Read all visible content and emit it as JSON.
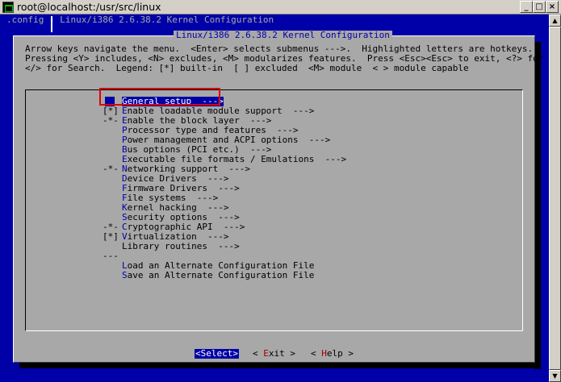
{
  "window": {
    "title": "root@localhost:/usr/src/linux",
    "min_glyph": "_",
    "max_glyph": "□",
    "close_glyph": "×"
  },
  "terminal": {
    "backtitle": ".config - Linux/i386 2.6.38.2 Kernel Configuration",
    "dialog_title": "Linux/i386 2.6.38.2 Kernel Configuration",
    "help_lines": [
      "Arrow keys navigate the menu.  <Enter> selects submenus --->.  Highlighted letters are hotkeys.",
      "Pressing <Y> includes, <N> excludes, <M> modularizes features.  Press <Esc><Esc> to exit, <?> for Help,",
      "</> for Search.  Legend: [*] built-in  [ ] excluded  <M> module  < > module capable"
    ]
  },
  "menu": {
    "items": [
      {
        "prefix": "",
        "hotkey": "G",
        "rest": "eneral setup  --->",
        "selected": true
      },
      {
        "prefix": "[*]",
        "hotkey": "E",
        "rest": "nable loadable module support  --->",
        "selected": false
      },
      {
        "prefix": "-*-",
        "hotkey": "E",
        "rest": "nable the block layer  --->",
        "selected": false
      },
      {
        "prefix": "",
        "hotkey": "P",
        "rest": "rocessor type and features  --->",
        "selected": false
      },
      {
        "prefix": "",
        "hotkey": "P",
        "rest": "ower management and ACPI options  --->",
        "selected": false
      },
      {
        "prefix": "",
        "hotkey": "B",
        "rest": "us options (PCI etc.)  --->",
        "selected": false
      },
      {
        "prefix": "",
        "hotkey": "E",
        "rest": "xecutable file formats / Emulations  --->",
        "selected": false
      },
      {
        "prefix": "-*-",
        "hotkey": "N",
        "rest": "etworking support  --->",
        "selected": false
      },
      {
        "prefix": "",
        "hotkey": "D",
        "rest": "evice Drivers  --->",
        "selected": false
      },
      {
        "prefix": "",
        "hotkey": "F",
        "rest": "irmware Drivers  --->",
        "selected": false
      },
      {
        "prefix": "",
        "hotkey": "F",
        "rest": "ile systems  --->",
        "selected": false
      },
      {
        "prefix": "",
        "hotkey": "K",
        "rest": "ernel hacking  --->",
        "selected": false
      },
      {
        "prefix": "",
        "hotkey": "S",
        "rest": "ecurity options  --->",
        "selected": false
      },
      {
        "prefix": "-*-",
        "hotkey": "C",
        "rest": "ryptographic API  --->",
        "selected": false
      },
      {
        "prefix": "[*]",
        "hotkey": "V",
        "rest": "irtualization  --->",
        "selected": false
      },
      {
        "prefix": "",
        "hotkey": "",
        "rest": "Library routines  --->",
        "selected": false
      },
      {
        "prefix": "---",
        "hotkey": "",
        "rest": "",
        "selected": false
      },
      {
        "prefix": "",
        "hotkey": "L",
        "rest": "oad an Alternate Configuration File",
        "selected": false
      },
      {
        "prefix": "",
        "hotkey": "S",
        "rest": "ave an Alternate Configuration File",
        "selected": false
      }
    ]
  },
  "buttons": {
    "select": {
      "pre": "<",
      "hotkey": "S",
      "rest": "elect>"
    },
    "exit": {
      "pre": "< ",
      "hotkey": "E",
      "rest": "xit >"
    },
    "help": {
      "pre": "< ",
      "hotkey": "H",
      "rest": "elp >"
    }
  },
  "scrollbar": {
    "up_glyph": "▲",
    "down_glyph": "▼"
  },
  "colors": {
    "terminal_bg": "#0000a8",
    "dialog_bg": "#a8a8a8",
    "highlight_box": "#e00000"
  }
}
